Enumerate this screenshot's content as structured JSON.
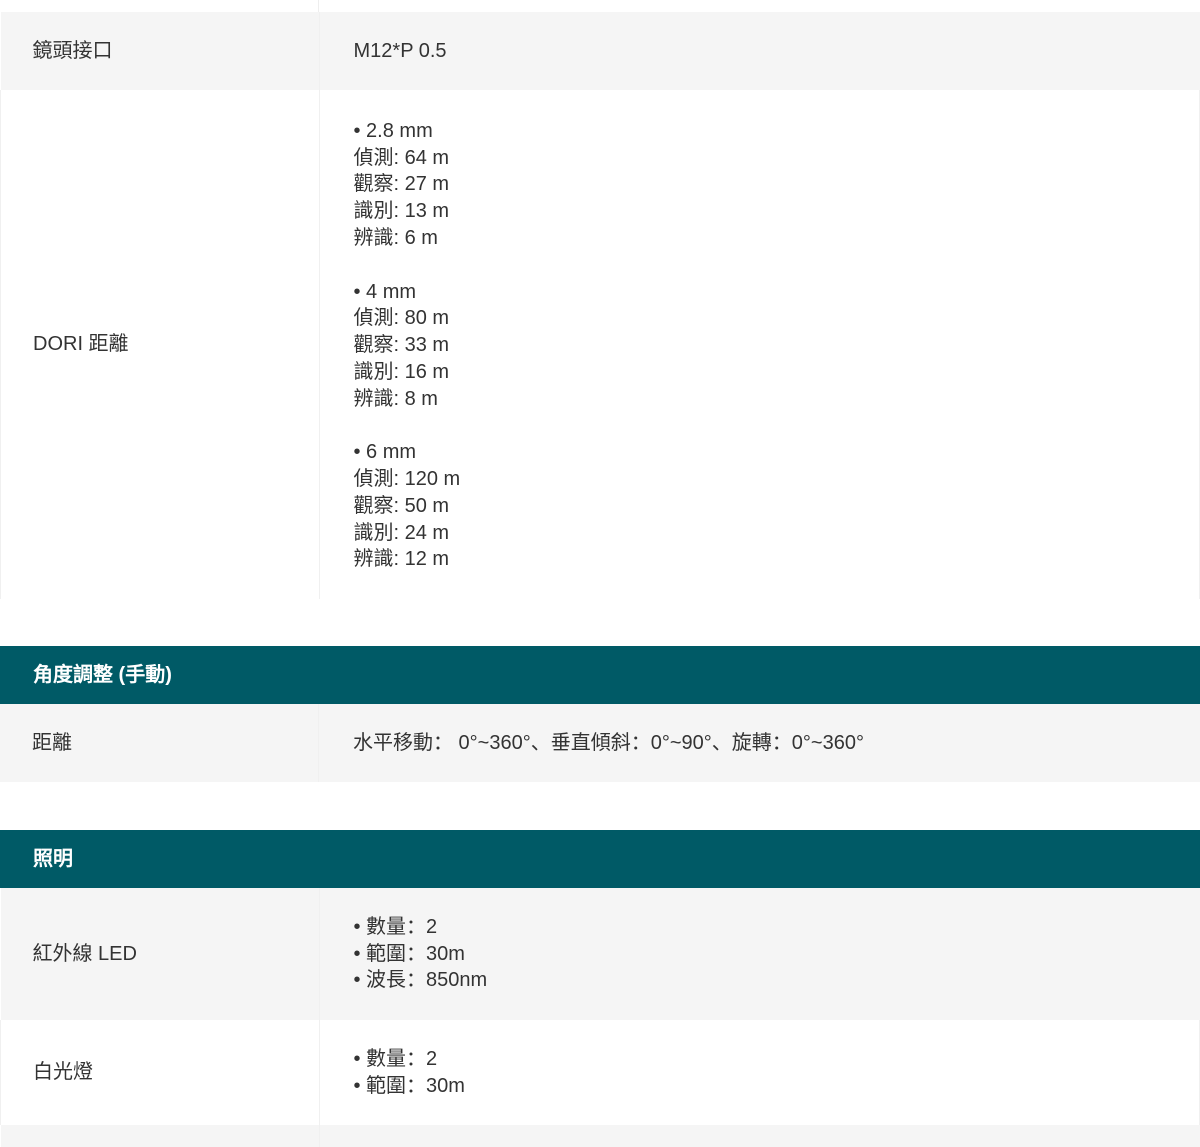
{
  "sections": {
    "lens": {
      "rows": [
        {
          "label": "鏡頭接口",
          "value": "M12*P 0.5"
        },
        {
          "label": "DORI 距離",
          "blocks": [
            [
              "• 2.8 mm",
              "偵測: 64 m",
              "觀察: 27 m",
              "識別: 13 m",
              "辨識: 6 m"
            ],
            [
              "• 4 mm",
              "偵測: 80 m",
              "觀察: 33 m",
              "識別: 16 m",
              "辨識: 8 m"
            ],
            [
              "• 6 mm",
              "偵測: 120 m",
              "觀察: 50 m",
              "識別: 24 m",
              "辨識: 12 m"
            ]
          ]
        }
      ]
    },
    "angle": {
      "title": "角度調整 (手動)",
      "rows": [
        {
          "label": "距離",
          "value": "水平移動： 0°~360°、垂直傾斜：0°~90°、旋轉：0°~360°"
        }
      ]
    },
    "lighting": {
      "title": "照明",
      "rows": [
        {
          "label": "紅外線 LED",
          "lines": [
            "• 數量：2",
            "• 範圍：30m",
            "• 波長：850nm"
          ]
        },
        {
          "label": "白光燈",
          "lines": [
            "• 數量：2",
            "• 範圍：30m"
          ]
        }
      ]
    }
  },
  "colors": {
    "header_bg": "#005a66",
    "header_text": "#ffffff",
    "row_shade": "#f5f5f5",
    "text": "#333333"
  }
}
